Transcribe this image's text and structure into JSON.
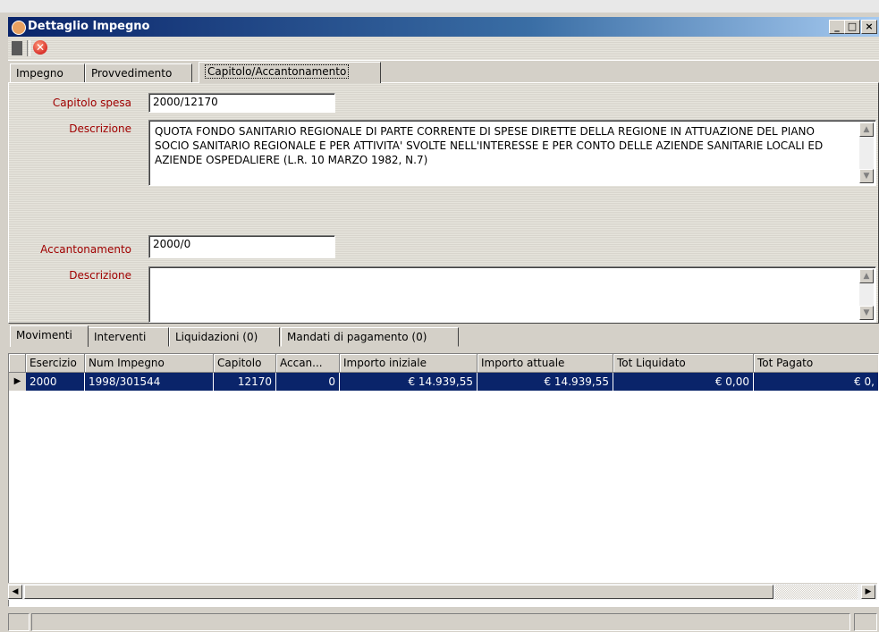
{
  "window": {
    "title": "Dettaglio Impegno"
  },
  "titlebar_buttons": {
    "minimize": "_",
    "maximize": "□",
    "close": "×"
  },
  "toolbar": {
    "close_symbol": "✕"
  },
  "tabs": [
    {
      "label": "Impegno",
      "active": false
    },
    {
      "label": "Provvedimento",
      "active": false
    },
    {
      "label": "Capitolo/Accantonamento",
      "active": true
    }
  ],
  "capitolo": {
    "label": "Capitolo spesa",
    "value": "2000/12170",
    "descrizione_label": "Descrizione",
    "descrizione_value": "QUOTA FONDO SANITARIO REGIONALE DI PARTE CORRENTE DI SPESE DIRETTE    DELLA REGIONE IN ATTUAZIONE DEL PIANO SOCIO SANITARIO REGIONALE E PER ATTIVITA' SVOLTE NELL'INTERESSE E PER CONTO DELLE AZIENDE SANITARIE   LOCALI ED AZIENDE OSPEDALIERE (L.R. 10 MARZO 1982, N.7)"
  },
  "accantonamento": {
    "label": "Accantonamento",
    "value": "2000/0",
    "descrizione_label": "Descrizione",
    "descrizione_value": ""
  },
  "bottom_tabs": [
    {
      "label": "Movimenti",
      "active": true
    },
    {
      "label": "Interventi",
      "active": false
    },
    {
      "label": "Liquidazioni (0)",
      "active": false
    },
    {
      "label": "Mandati di pagamento (0)",
      "active": false
    }
  ],
  "grid": {
    "columns": [
      "Esercizio",
      "Num Impegno",
      "Capitolo",
      "Accan...",
      "Importo iniziale",
      "Importo attuale",
      "Tot Liquidato",
      "Tot Pagato"
    ],
    "rows": [
      [
        "2000",
        "1998/301544",
        "12170",
        "0",
        "€ 14.939,55",
        "€ 14.939,55",
        "€ 0,00",
        "€ 0,"
      ]
    ]
  },
  "scroll_arrows": {
    "up": "▲",
    "down": "▼",
    "left": "◀",
    "right": "▶",
    "row_marker": "▶"
  }
}
